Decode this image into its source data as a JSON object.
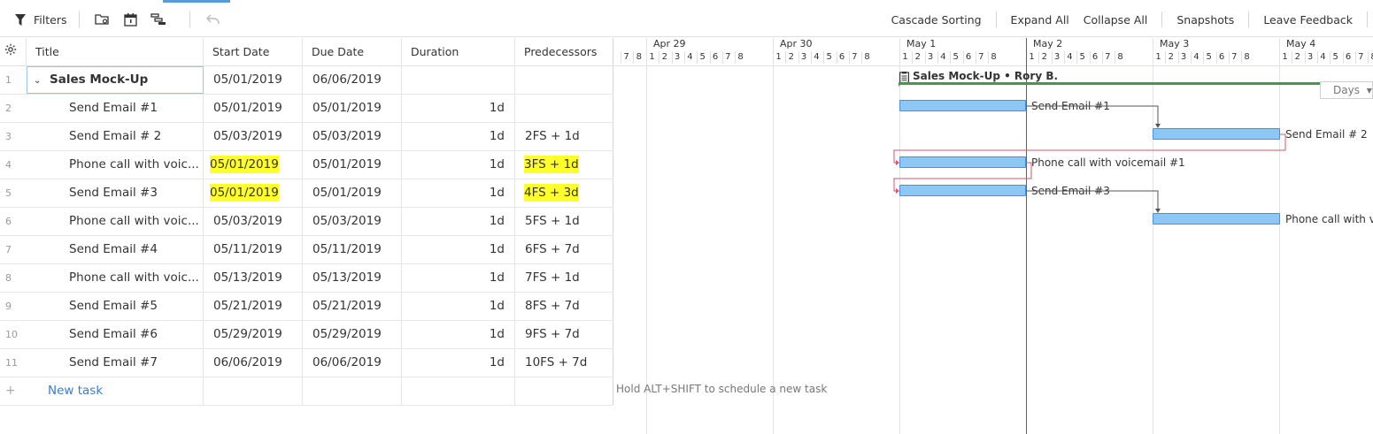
{
  "toolbar": {
    "filters_label": "Filters",
    "cascade_sorting": "Cascade Sorting",
    "expand_all": "Expand All",
    "collapse_all": "Collapse All",
    "snapshots": "Snapshots",
    "leave_feedback": "Leave Feedback"
  },
  "grid": {
    "headers": {
      "title": "Title",
      "start": "Start Date",
      "due": "Due Date",
      "duration": "Duration",
      "predecessors": "Predecessors"
    },
    "rows": [
      {
        "num": "1",
        "title": "Sales Mock-Up",
        "start": "05/01/2019",
        "due": "06/06/2019",
        "duration": "",
        "pred": ""
      },
      {
        "num": "2",
        "title": "Send Email #1",
        "start": "05/01/2019",
        "due": "05/01/2019",
        "duration": "1d",
        "pred": ""
      },
      {
        "num": "3",
        "title": "Send Email # 2",
        "start": "05/03/2019",
        "due": "05/03/2019",
        "duration": "1d",
        "pred": "2FS + 1d"
      },
      {
        "num": "4",
        "title": "Phone call with voic...",
        "start": "05/01/2019",
        "due": "05/01/2019",
        "duration": "1d",
        "pred": "3FS + 1d"
      },
      {
        "num": "5",
        "title": "Send Email #3",
        "start": "05/01/2019",
        "due": "05/01/2019",
        "duration": "1d",
        "pred": "4FS + 3d"
      },
      {
        "num": "6",
        "title": "Phone call with voic...",
        "start": "05/03/2019",
        "due": "05/03/2019",
        "duration": "1d",
        "pred": "5FS + 1d"
      },
      {
        "num": "7",
        "title": "Send Email #4",
        "start": "05/11/2019",
        "due": "05/11/2019",
        "duration": "1d",
        "pred": "6FS + 7d"
      },
      {
        "num": "8",
        "title": "Phone call with voic...",
        "start": "05/13/2019",
        "due": "05/13/2019",
        "duration": "1d",
        "pred": "7FS + 1d"
      },
      {
        "num": "9",
        "title": "Send Email #5",
        "start": "05/21/2019",
        "due": "05/21/2019",
        "duration": "1d",
        "pred": "8FS + 7d"
      },
      {
        "num": "10",
        "title": "Send Email #6",
        "start": "05/29/2019",
        "due": "05/29/2019",
        "duration": "1d",
        "pred": "9FS + 7d"
      },
      {
        "num": "11",
        "title": "Send Email #7",
        "start": "06/06/2019",
        "due": "06/06/2019",
        "duration": "1d",
        "pred": "10FS + 7d"
      }
    ],
    "new_row": {
      "num": "+",
      "label": "New task"
    }
  },
  "gantt": {
    "days": [
      "Apr 29",
      "Apr 30",
      "May 1",
      "May 2",
      "May 3",
      "May 4"
    ],
    "hours": [
      "7",
      "8",
      "1",
      "2",
      "3",
      "4",
      "5",
      "6",
      "7",
      "8"
    ],
    "parent_label": "Sales Mock-Up • Rory B.",
    "scale": "Days",
    "bar_labels": [
      "Send Email #1",
      "Send Email # 2",
      "Phone call with voicemail #1",
      "Send Email #3",
      "Phone call with vo"
    ],
    "hint": "Hold ALT+SHIFT to schedule a new task"
  },
  "colors": {
    "accent": "#5b9bd5",
    "highlight": "#ffff29",
    "bar": "#8ec7f5",
    "summary": "#3a9f45",
    "today": "#c0392b"
  }
}
